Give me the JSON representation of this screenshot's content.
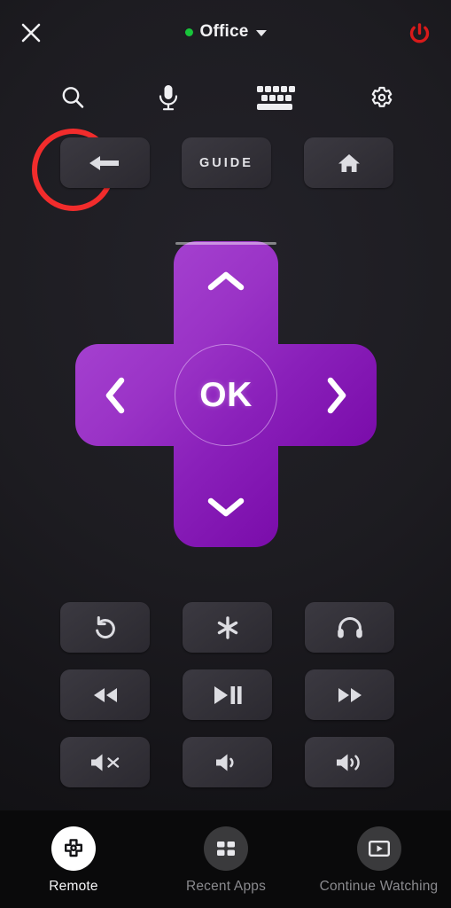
{
  "header": {
    "close_icon": "close-icon",
    "device_status_dot_color": "#18c43a",
    "device_name": "Office",
    "device_caret_icon": "chevron-down-icon",
    "power_icon": "power-icon",
    "power_color": "#d81a1a"
  },
  "quick_actions": [
    {
      "name": "search",
      "icon": "search-icon",
      "highlighted": true
    },
    {
      "name": "voice",
      "icon": "microphone-icon",
      "highlighted": false
    },
    {
      "name": "keyboard",
      "icon": "keyboard-icon",
      "highlighted": false
    },
    {
      "name": "settings",
      "icon": "gear-icon",
      "highlighted": false
    }
  ],
  "highlight": {
    "color": "#f22c2c",
    "target": "search"
  },
  "top_buttons": [
    {
      "name": "back",
      "icon": "arrow-left-icon",
      "label": ""
    },
    {
      "name": "guide",
      "icon": "",
      "label": "GUIDE"
    },
    {
      "name": "home",
      "icon": "home-icon",
      "label": ""
    }
  ],
  "dpad": {
    "up_icon": "chevron-up-icon",
    "down_icon": "chevron-down-icon",
    "left_icon": "chevron-left-icon",
    "right_icon": "chevron-right-icon",
    "ok_label": "OK",
    "color_light": "#a440cf",
    "color_dark": "#74049f"
  },
  "control_grid": [
    {
      "name": "instant-replay",
      "icon": "replay-icon"
    },
    {
      "name": "options",
      "icon": "star-icon"
    },
    {
      "name": "private-listening",
      "icon": "headphones-icon"
    },
    {
      "name": "rewind",
      "icon": "rewind-icon"
    },
    {
      "name": "play-pause",
      "icon": "play-pause-icon"
    },
    {
      "name": "fast-forward",
      "icon": "fast-forward-icon"
    },
    {
      "name": "mute",
      "icon": "volume-mute-icon"
    },
    {
      "name": "volume-down",
      "icon": "volume-down-icon"
    },
    {
      "name": "volume-up",
      "icon": "volume-up-icon"
    }
  ],
  "bottom_nav": [
    {
      "name": "remote",
      "label": "Remote",
      "icon": "dpad-icon",
      "active": true
    },
    {
      "name": "recent-apps",
      "label": "Recent Apps",
      "icon": "grid-icon",
      "active": false
    },
    {
      "name": "continue-watching",
      "label": "Continue Watching",
      "icon": "play-rect-icon",
      "active": false
    }
  ]
}
